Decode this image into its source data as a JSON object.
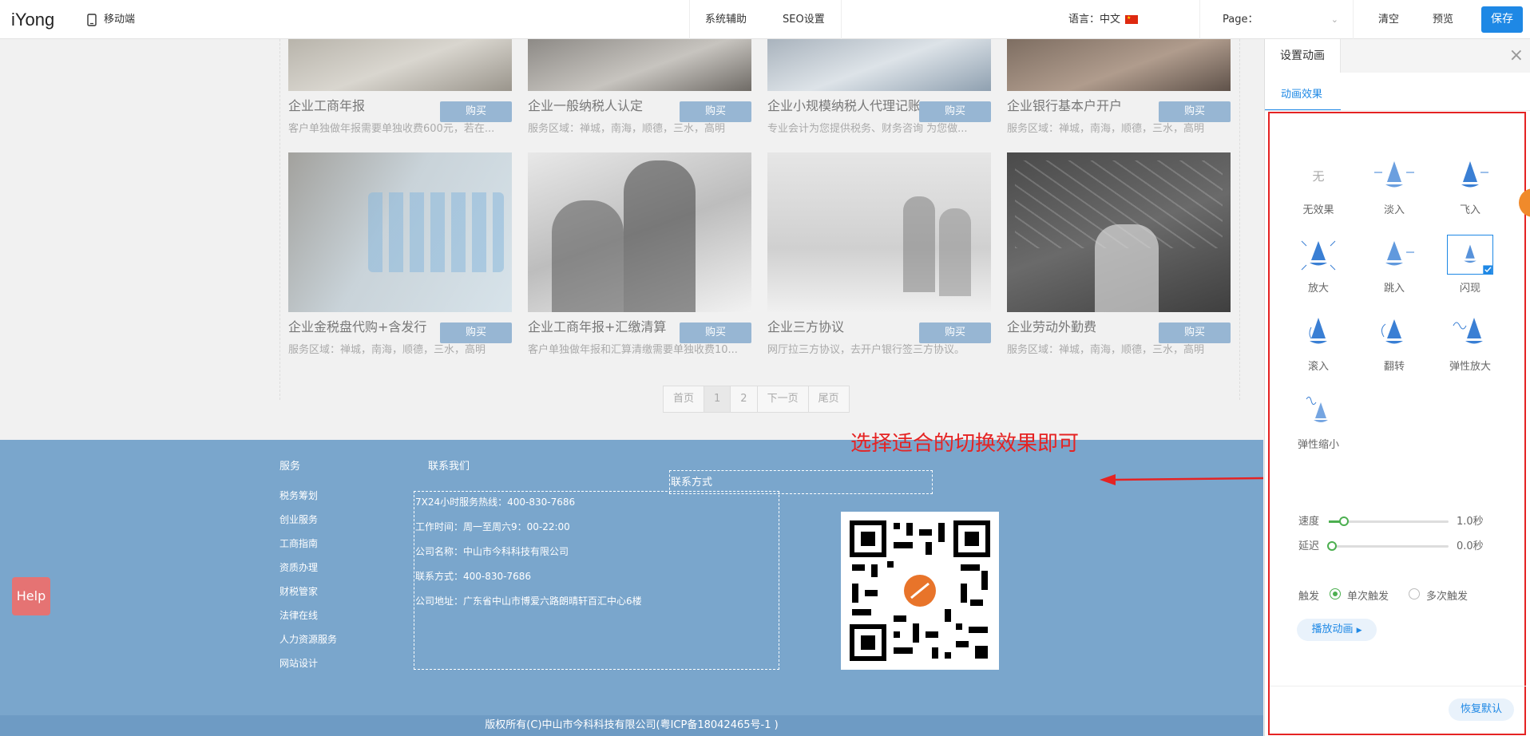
{
  "topbar": {
    "logo": "iYong",
    "mobile_label": "移动端",
    "system_assist": "系统辅助",
    "seo": "SEO设置",
    "language_label": "语言：中文",
    "page_label": "Page：",
    "clear": "清空",
    "preview": "预览",
    "save": "保存"
  },
  "products": [
    {
      "title": "企业工商年报",
      "desc": "客户单独做年报需要单独收费600元，若在...",
      "buy": "购买"
    },
    {
      "title": "企业一般纳税人认定",
      "desc": "服务区域：禅城，南海，顺德，三水，高明",
      "buy": "购买"
    },
    {
      "title": "企业小规模纳税人代理记账",
      "desc": "专业会计为您提供税务、财务咨询 为您做...",
      "buy": "购买"
    },
    {
      "title": "企业银行基本户开户",
      "desc": "服务区域：禅城，南海，顺德，三水，高明",
      "buy": "购买"
    },
    {
      "title": "企业金税盘代购+含发行",
      "desc": "服务区域：禅城，南海，顺德，三水，高明",
      "buy": "购买"
    },
    {
      "title": "企业工商年报+汇缴清算",
      "desc": "客户单独做年报和汇算清缴需要单独收费10...",
      "buy": "购买"
    },
    {
      "title": "企业三方协议",
      "desc": "网厅拉三方协议，去开户银行签三方协议。",
      "buy": "购买"
    },
    {
      "title": "企业劳动外勤费",
      "desc": "服务区域：禅城，南海，顺德，三水，高明",
      "buy": "购买"
    }
  ],
  "pager": [
    "首页",
    "1",
    "2",
    "下一页",
    "尾页"
  ],
  "footer": {
    "services_title": "服务",
    "contact_title": "联系我们",
    "contact_box_title": "联系方式",
    "services": [
      "税务筹划",
      "创业服务",
      "工商指南",
      "资质办理",
      "财税管家",
      "法律在线",
      "人力资源服务",
      "网站设计"
    ],
    "contact_lines": [
      "7X24小时服务热线：400-830-7686",
      "工作时间：周一至周六9：00-22:00",
      "公司名称：中山市今科科技有限公司",
      " 联系方式：400-830-7686",
      "公司地址：广东省中山市博爱六路朗晴轩百汇中心6楼"
    ],
    "copyright": "版权所有(C)中山市今科科技有限公司(粤ICP备18042465号-1 )"
  },
  "help": "Help",
  "annotation": "选择适合的切换效果即可",
  "panel": {
    "tab": "设置动画",
    "subtab": "动画效果",
    "effects": [
      "无效果",
      "淡入",
      "飞入",
      "放大",
      "跳入",
      "闪现",
      "滚入",
      "翻转",
      "弹性放大",
      "弹性缩小"
    ],
    "none_glyph": "无",
    "selected_effect": "闪现",
    "speed_label": "速度",
    "speed_value": "1.0秒",
    "speed_fraction": 0.1,
    "delay_label": "延迟",
    "delay_value": "0.0秒",
    "delay_fraction": 0.0,
    "trigger_label": "触发",
    "trigger_single": "单次触发",
    "trigger_multi": "多次触发",
    "trigger_selected": "单次触发",
    "play": "播放动画",
    "restore": "恢复默认"
  },
  "colors": {
    "accent": "#1e88e5",
    "annotation": "#e52323",
    "footer": "#7aa6cc",
    "help": "#e57373"
  }
}
